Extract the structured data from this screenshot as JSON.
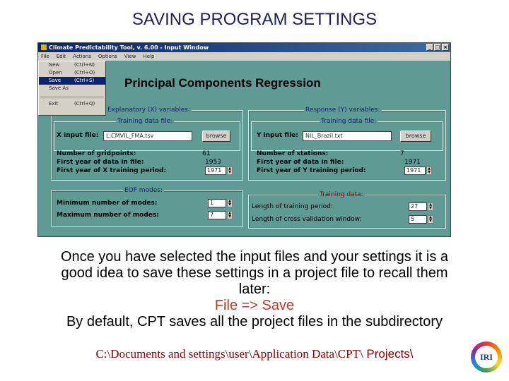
{
  "slide": {
    "title": "SAVING PROGRAM SETTINGS"
  },
  "window": {
    "title": "Climate Predictability Tool, v. 6.00 - Input Window",
    "menubar": [
      "File",
      "Edit",
      "Actions",
      "Options",
      "View",
      "Help"
    ],
    "heading": "Principal Components Regression"
  },
  "file_menu": {
    "items": [
      {
        "label": "New",
        "shortcut": "(Ctrl+N)"
      },
      {
        "label": "Open",
        "shortcut": "(Ctrl+O)"
      },
      {
        "label": "Save",
        "shortcut": "(Ctrl+S)"
      },
      {
        "label": "Save As",
        "shortcut": ""
      },
      {
        "label": "Exit",
        "shortcut": "(Ctrl+Q)"
      }
    ],
    "selected": "Save"
  },
  "x_panel": {
    "group_label": "Explanatory (X) variables:",
    "sub_label": "Training data file:",
    "input_file_label": "X input file:",
    "input_file_value": "L:CMVIL_FMA.tsv",
    "browse_label": "browse",
    "rows": [
      {
        "label": "Number of gridpoints:",
        "value": "61"
      },
      {
        "label": "First year of data in file:",
        "value": "1953"
      },
      {
        "label": "First year of X training period:",
        "value": "1971"
      }
    ]
  },
  "y_panel": {
    "group_label": "Response (Y) variables:",
    "sub_label": "Training data file:",
    "input_file_label": "Y input file:",
    "input_file_value": "NIL_Brazil.txt",
    "browse_label": "browse",
    "rows": [
      {
        "label": "Number of stations:",
        "value": "7"
      },
      {
        "label": "First year of data in file:",
        "value": "1971"
      },
      {
        "label": "First year of Y training period:",
        "value": "1971"
      }
    ]
  },
  "eof_panel": {
    "group_label": "EOF modes:",
    "rows": [
      {
        "label": "Minimum number of modes:",
        "value": "1"
      },
      {
        "label": "Maximum number of modes:",
        "value": "7"
      }
    ]
  },
  "training_panel": {
    "group_label": "Training data:",
    "rows": [
      {
        "label": "Length of training period:",
        "value": "27"
      },
      {
        "label": "Length of cross validation window:",
        "value": "5"
      }
    ]
  },
  "caption": {
    "line1": "Once you have selected the input files and your settings it is a",
    "line2": "good idea to save these settings in a project file to recall them",
    "line3": "later:",
    "file_save": "File => Save",
    "line4": "By default, CPT saves all the project files in the subdirectory",
    "path_main": "C:\\Documents and settings\\user\\Application Data\\CPT\\",
    "path_end": " Projects\\"
  },
  "logo": {
    "text": "IRI"
  },
  "colors": {
    "window_bg": "#5f9a95",
    "title_color": "#1f1f5c",
    "accent_red": "#c0392b",
    "path_color": "#8b0000"
  }
}
